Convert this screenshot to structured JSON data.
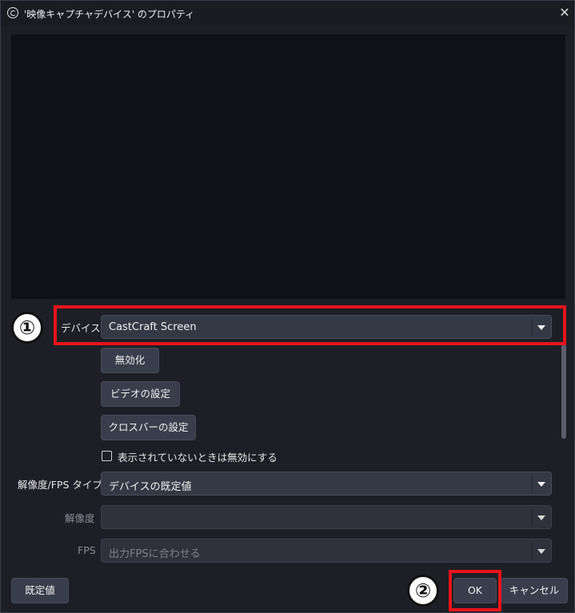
{
  "window": {
    "title": "'映像キャプチャデバイス' のプロパティ",
    "close_glyph": "✕",
    "icon": "obs-icon"
  },
  "form": {
    "device": {
      "label": "デバイス",
      "value": "CastCraft Screen"
    },
    "buttons": {
      "deactivate": "無効化",
      "video_settings": "ビデオの設定",
      "crossbar_settings": "クロスバーの設定"
    },
    "checkbox": {
      "label": "表示されていないときは無効にする",
      "checked": false
    },
    "resolution_type": {
      "label": "解像度/FPS タイプ",
      "value": "デバイスの既定値"
    },
    "resolution": {
      "label": "解像度",
      "value": ""
    },
    "fps": {
      "label": "FPS",
      "value": "出力FPSに合わせる"
    }
  },
  "footer": {
    "defaults_label": "既定値",
    "ok_label": "OK",
    "cancel_label": "キャンセル"
  },
  "annotations": {
    "marker1": "①",
    "marker2": "②",
    "highlight_color": "#e8141b"
  }
}
